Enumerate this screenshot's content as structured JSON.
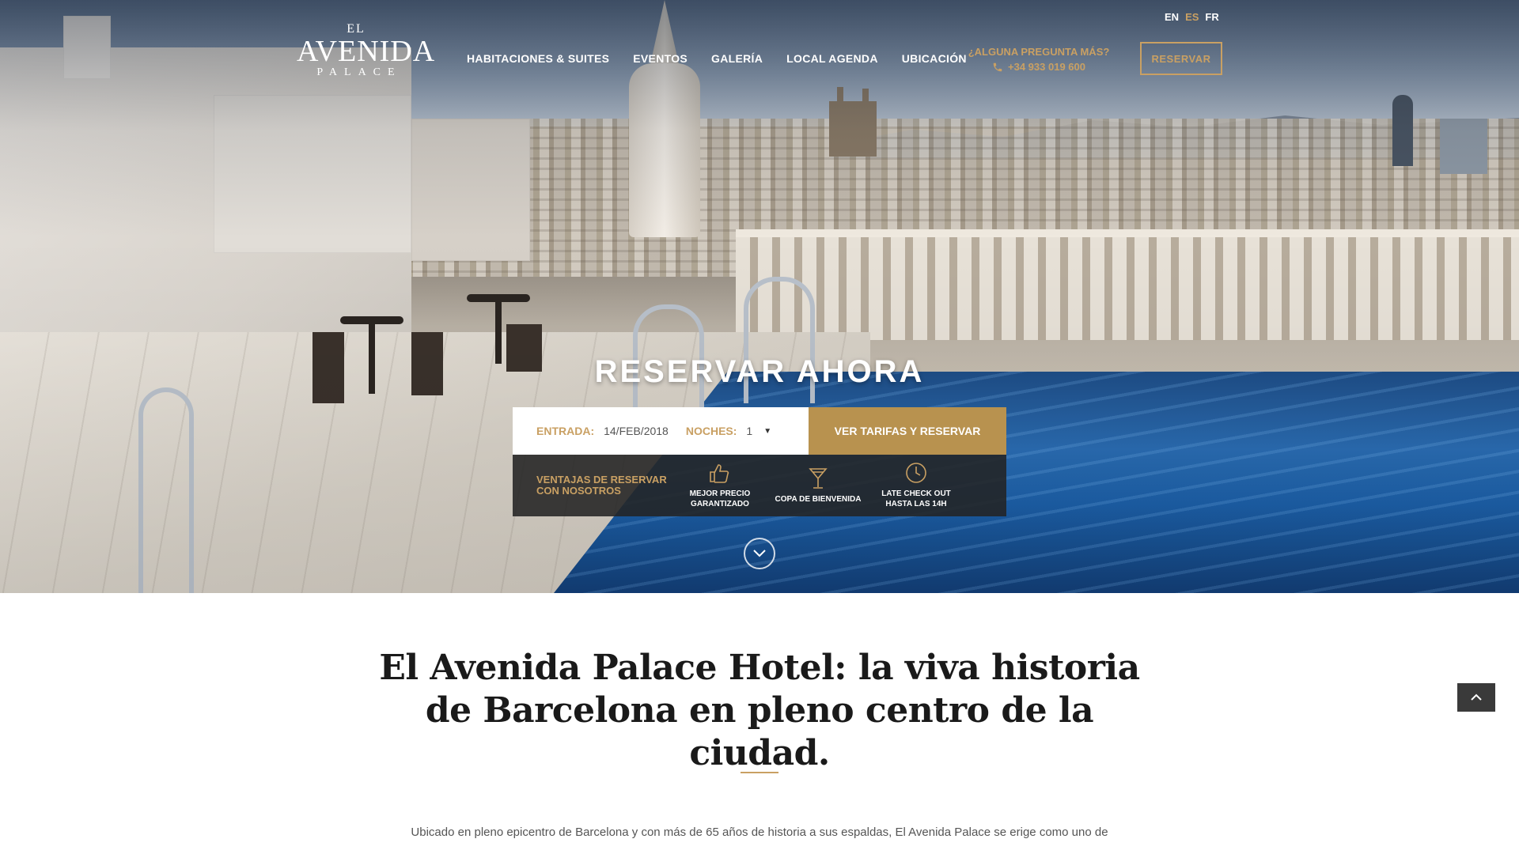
{
  "header": {
    "logo": {
      "el": "EL",
      "name": "AVENIDA",
      "sub": "PALACE"
    },
    "languages": [
      {
        "code": "EN",
        "active": false
      },
      {
        "code": "ES",
        "active": true
      },
      {
        "code": "FR",
        "active": false
      }
    ],
    "nav": [
      "HABITACIONES & SUITES",
      "EVENTOS",
      "GALERÍA",
      "LOCAL AGENDA",
      "UBICACIÓN"
    ],
    "contact": {
      "question": "¿ALGUNA PREGUNTA MÁS?",
      "phone": "+34 933 019 600",
      "phone_icon": "phone-icon"
    },
    "reservar_label": "RESERVAR"
  },
  "booking": {
    "title": "RESERVAR AHORA",
    "entrada_label": "ENTRADA:",
    "entrada_value": "14/FEB/2018",
    "noches_label": "NOCHES:",
    "noches_value": "1",
    "cta_label": "VER TARIFAS Y RESERVAR",
    "perks_title": "VENTAJAS DE RESERVAR CON NOSOTROS",
    "perks": [
      {
        "icon": "thumbs-up-icon",
        "label": "MEJOR PRECIO GARANTIZADO"
      },
      {
        "icon": "cocktail-icon",
        "label": "COPA DE BIENVENIDA"
      },
      {
        "icon": "clock-icon",
        "label": "LATE CHECK OUT HASTA LAS 14H"
      }
    ]
  },
  "content": {
    "heading": "El Avenida Palace Hotel: la viva historia de Barcelona en pleno centro de la ciudad.",
    "intro": "Ubicado en pleno epicentro de Barcelona y con más de 65 años de historia a sus espaldas, El Avenida Palace se erige como uno de"
  },
  "colors": {
    "gold": "#c9a063",
    "gold_button": "#b8924f",
    "dark_panel": "#232323"
  }
}
